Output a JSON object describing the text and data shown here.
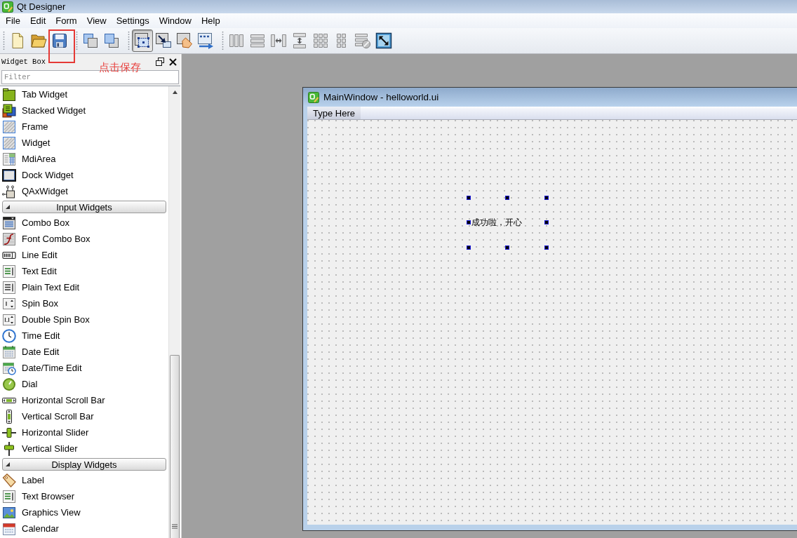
{
  "app_window": {
    "title": "Qt Designer"
  },
  "menu_bar": [
    "File",
    "Edit",
    "Form",
    "View",
    "Settings",
    "Window",
    "Help"
  ],
  "toolbar": {
    "groups": [
      {
        "buttons": [
          {
            "disabled": false
          },
          {
            "disabled": false
          },
          {
            "disabled": false
          }
        ]
      },
      {
        "buttons": [
          {
            "disabled": false
          },
          {
            "disabled": false
          }
        ]
      },
      {
        "buttons": [
          {
            "selected": true,
            "disabled": false
          },
          {
            "selected": false,
            "disabled": false
          },
          {
            "selected": false,
            "disabled": false
          },
          {
            "selected": false,
            "disabled": false
          }
        ]
      },
      {
        "buttons": [
          {
            "disabled": true
          },
          {
            "disabled": true
          },
          {
            "disabled": true
          },
          {
            "disabled": true
          },
          {
            "disabled": true
          },
          {
            "disabled": true
          },
          {
            "disabled": true
          },
          {
            "disabled": false
          }
        ]
      }
    ]
  },
  "annotation": {
    "text": "点击保存"
  },
  "widget_box": {
    "title": "Widget Box",
    "filter": {
      "placeholder": "Filter"
    },
    "items": [
      "Tab Widget",
      "Stacked Widget",
      "Frame",
      "Widget",
      "MdiArea",
      "Dock Widget",
      "QAxWidget"
    ],
    "sections": [
      {
        "label": "Input Widgets",
        "expanded": true,
        "items": [
          "Combo Box",
          "Font Combo Box",
          "Line Edit",
          "Text Edit",
          "Plain Text Edit",
          "Spin Box",
          "Double Spin Box",
          "Time Edit",
          "Date Edit",
          "Date/Time Edit",
          "Dial",
          "Horizontal Scroll Bar",
          "Vertical Scroll Bar",
          "Horizontal Slider",
          "Vertical Slider"
        ]
      },
      {
        "label": "Display Widgets",
        "expanded": true,
        "items": [
          "Label",
          "Text Browser",
          "Graphics View",
          "Calendar"
        ]
      }
    ]
  },
  "form_window": {
    "title": "MainWindow - helloworld.ui",
    "menu_bar": [
      "Type Here"
    ],
    "label": {
      "text": "成功啦，开心",
      "selected": true
    }
  }
}
